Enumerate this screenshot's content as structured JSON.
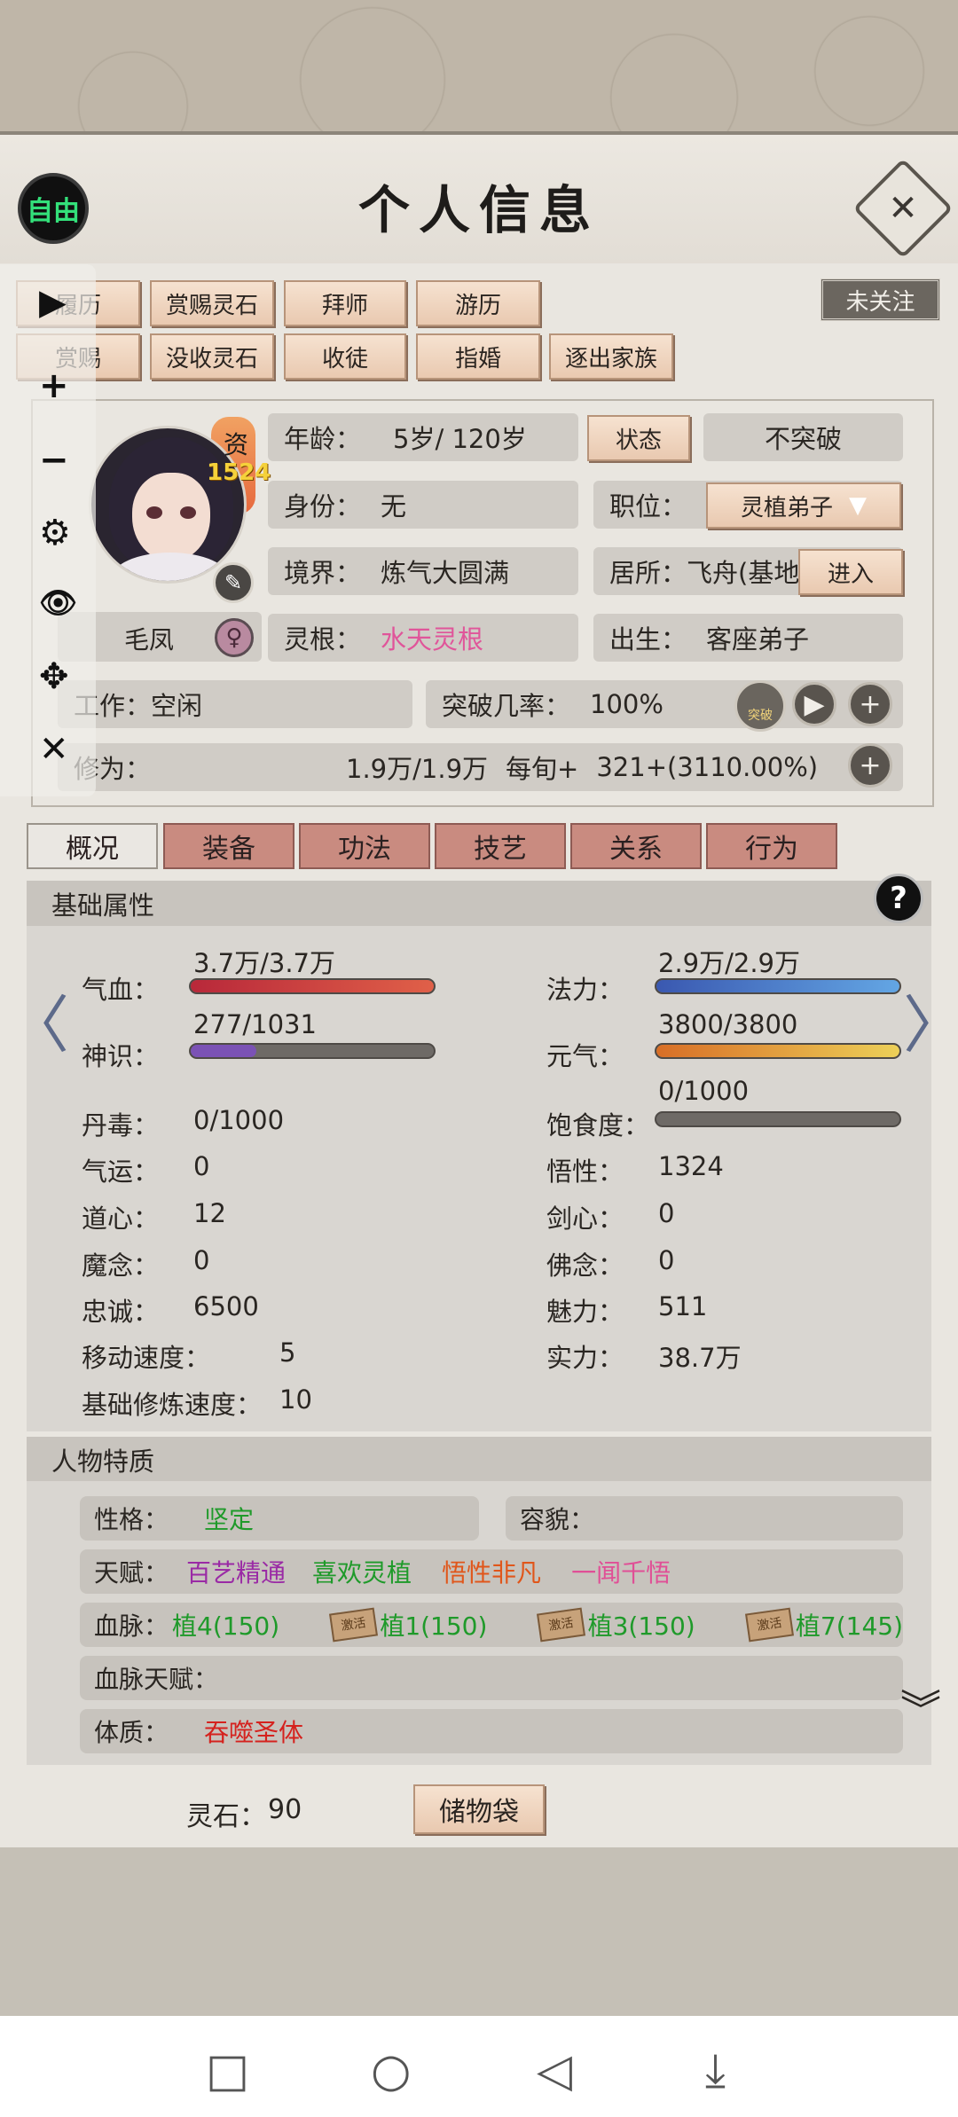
{
  "header": {
    "title": "个人信息",
    "free_label": "自由",
    "close_icon": "✕",
    "follow_label": "未关注"
  },
  "actions_row1": [
    "履历",
    "赏赐灵石",
    "拜师",
    "游历"
  ],
  "actions_row2": [
    "赏赐",
    "没收灵石",
    "收徒",
    "指婚",
    "逐出家族"
  ],
  "profile": {
    "zi": "资",
    "zi_value": "1524",
    "name": "毛凤",
    "gender_icon": "♀",
    "age_label": "年龄：",
    "age_value": "5岁/ 120岁",
    "status_btn": "状态",
    "breakthrough_state": "不突破",
    "identity_label": "身份：",
    "identity_value": "无",
    "position_label": "职位：",
    "position_value": "灵植弟子",
    "realm_label": "境界：",
    "realm_value": "炼气大圆满",
    "residence_label": "居所：",
    "residence_value": "飞舟(基地",
    "enter_btn": "进入",
    "root_label": "灵根：",
    "root_value": "水天灵根",
    "birth_label": "出生：",
    "birth_value": "客座弟子",
    "work_label": "工作：",
    "work_value": "空闲",
    "breakrate_label": "突破几率：",
    "breakrate_value": "100%",
    "tupo_label": "突破",
    "cultivation_label": "修为：",
    "cultivation_value": "1.9万/1.9万",
    "per_turn_label": "每旬+",
    "per_turn_value": "321+(3110.00%)"
  },
  "tabs": [
    "概况",
    "装备",
    "功法",
    "技艺",
    "关系",
    "行为"
  ],
  "sections": {
    "basic": "基础属性",
    "traits": "人物特质",
    "help": "?"
  },
  "stats": {
    "qixue_label": "气血：",
    "qixue_value": "3.7万/3.7万",
    "qixue_ratio": 1.0,
    "fali_label": "法力：",
    "fali_value": "2.9万/2.9万",
    "fali_ratio": 1.0,
    "shenshi_label": "神识：",
    "shenshi_value": "277/1031",
    "shenshi_ratio": 0.27,
    "yuanqi_label": "元气：",
    "yuanqi_value": "3800/3800",
    "yuanqi_ratio": 1.0,
    "satiety_label": "饱食度：",
    "satiety_value": "0/1000",
    "satiety_ratio": 0.0,
    "dandu_label": "丹毒：",
    "dandu_value": "0/1000",
    "qiyun_label": "气运：",
    "qiyun_value": "0",
    "wuxing_label": "悟性：",
    "wuxing_value": "1324",
    "daoxin_label": "道心：",
    "daoxin_value": "12",
    "jianxin_label": "剑心：",
    "jianxin_value": "0",
    "monian_label": "魔念：",
    "monian_value": "0",
    "fonian_label": "佛念：",
    "fonian_value": "0",
    "zhongcheng_label": "忠诚：",
    "zhongcheng_value": "6500",
    "meili_label": "魅力：",
    "meili_value": "511",
    "speed_label": "移动速度：",
    "speed_value": "5",
    "power_label": "实力：",
    "power_value": "38.7万",
    "train_label": "基础修炼速度：",
    "train_value": "10"
  },
  "traits": {
    "personality_label": "性格：",
    "personality_value": "坚定",
    "looks_label": "容貌：",
    "talent_label": "天赋：",
    "talents": [
      "百艺精通",
      "喜欢灵植",
      "悟性非凡",
      "一闻千悟"
    ],
    "blood_label": "血脉：",
    "blood_tag": "激活",
    "blood": [
      "植4(150)",
      "植1(150)",
      "植3(150)",
      "植7(145)"
    ],
    "blood_talent_label": "血脉天赋：",
    "physique_label": "体质：",
    "physique_value": "吞噬圣体"
  },
  "footer": {
    "stones_label": "灵石：",
    "stones_value": "90",
    "bag_btn": "储物袋"
  },
  "floating_tools": [
    "▶",
    "+",
    "−",
    "⚙",
    "👁",
    "✥",
    "✕"
  ],
  "colors": {
    "qixue": "#c9383c",
    "fali": "#3c6fc0",
    "shenshi": "#7b52b5",
    "yuanqi": "#e0862c",
    "accent": "#e9c9b0"
  }
}
